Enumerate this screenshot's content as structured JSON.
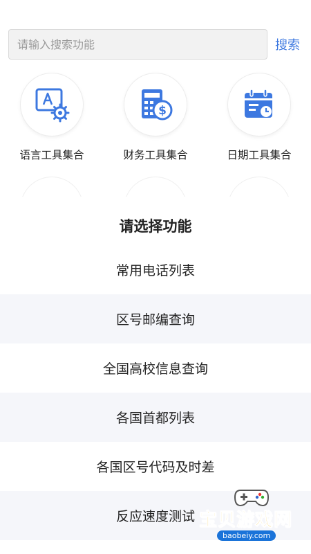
{
  "search": {
    "placeholder": "请输入搜索功能",
    "button_label": "搜索"
  },
  "tools": [
    {
      "label": "语言工具集合",
      "icon": "language-tool-icon"
    },
    {
      "label": "财务工具集合",
      "icon": "finance-tool-icon"
    },
    {
      "label": "日期工具集合",
      "icon": "date-tool-icon"
    }
  ],
  "sheet": {
    "title": "请选择功能",
    "options": [
      "常用电话列表",
      "区号邮编查询",
      "全国高校信息查询",
      "各国首都列表",
      "各国区号代码及时差",
      "反应速度测试"
    ]
  },
  "watermark": {
    "text": "宝贝游戏网",
    "url": "baobeiy.com"
  },
  "colors": {
    "accent": "#3d78e0",
    "alt_row": "#f5f6fa",
    "watermark_yellow": "#f0b400"
  }
}
